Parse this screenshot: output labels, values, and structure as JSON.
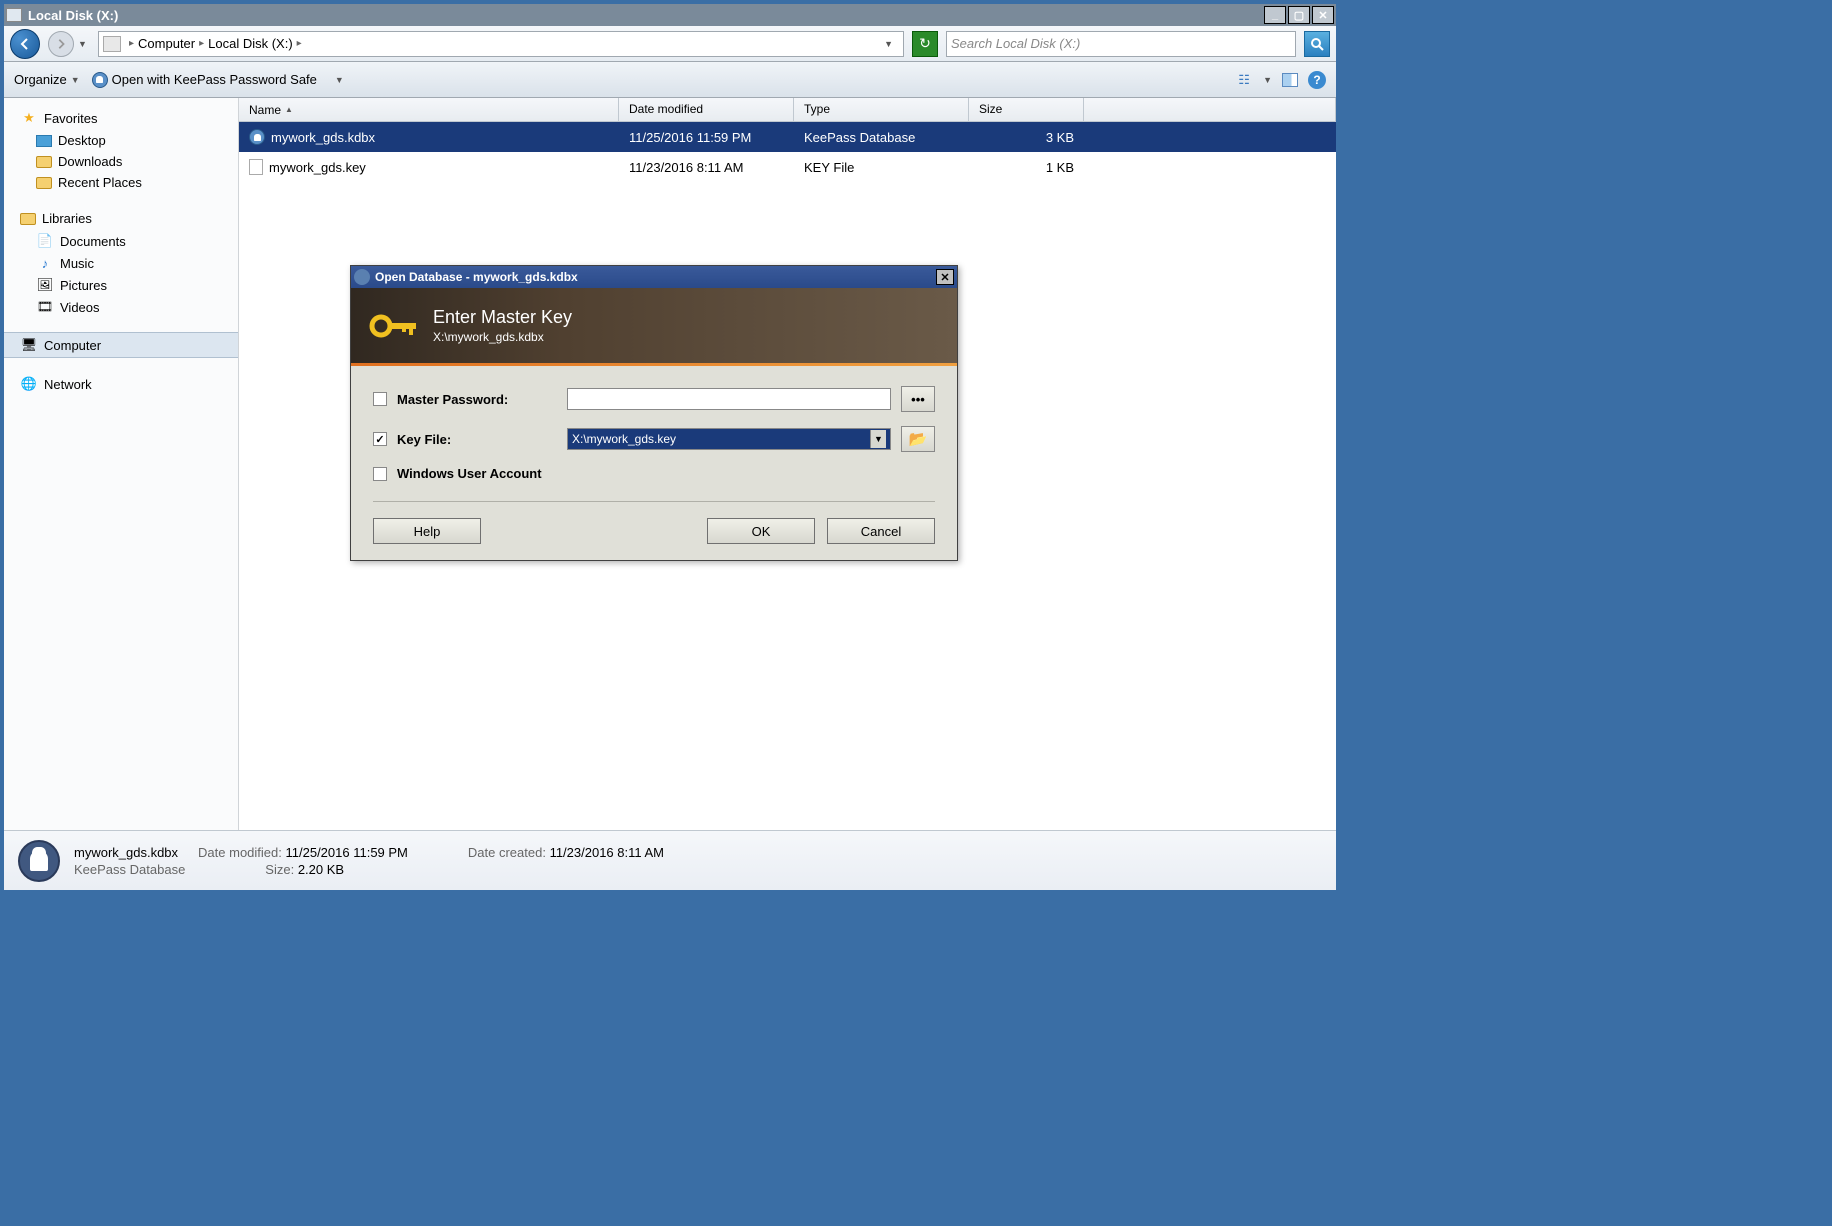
{
  "window": {
    "title": "Local Disk (X:)"
  },
  "breadcrumb": {
    "root": "Computer",
    "current": "Local Disk (X:)"
  },
  "search": {
    "placeholder": "Search Local Disk (X:)"
  },
  "toolbar": {
    "organize": "Organize",
    "open_with": "Open with KeePass Password Safe"
  },
  "sidebar": {
    "favorites": {
      "header": "Favorites",
      "items": [
        "Desktop",
        "Downloads",
        "Recent Places"
      ]
    },
    "libraries": {
      "header": "Libraries",
      "items": [
        "Documents",
        "Music",
        "Pictures",
        "Videos"
      ]
    },
    "computer": "Computer",
    "network": "Network"
  },
  "columns": {
    "name": "Name",
    "date": "Date modified",
    "type": "Type",
    "size": "Size"
  },
  "files": [
    {
      "name": "mywork_gds.kdbx",
      "date": "11/25/2016 11:59 PM",
      "type": "KeePass Database",
      "size": "3 KB",
      "selected": true
    },
    {
      "name": "mywork_gds.key",
      "date": "11/23/2016 8:11 AM",
      "type": "KEY File",
      "size": "1 KB",
      "selected": false
    }
  ],
  "details": {
    "name": "mywork_gds.kdbx",
    "type": "KeePass Database",
    "date_modified_label": "Date modified:",
    "date_modified": "11/25/2016 11:59 PM",
    "size_label": "Size:",
    "size": "2.20 KB",
    "date_created_label": "Date created:",
    "date_created": "11/23/2016 8:11 AM"
  },
  "dialog": {
    "title": "Open Database - mywork_gds.kdbx",
    "banner_title": "Enter Master Key",
    "banner_sub": "X:\\mywork_gds.kdbx",
    "master_password_label": "Master Password:",
    "master_password_checked": false,
    "key_file_label": "Key File:",
    "key_file_checked": true,
    "key_file_value": "X:\\mywork_gds.key",
    "windows_account_label": "Windows User Account",
    "windows_account_checked": false,
    "show_password_btn": "•••",
    "help": "Help",
    "ok": "OK",
    "cancel": "Cancel"
  }
}
